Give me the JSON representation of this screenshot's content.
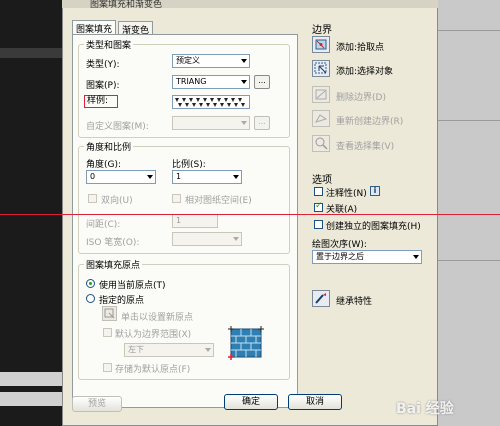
{
  "window": {
    "title": "图案填充和渐变色"
  },
  "tabs": [
    {
      "label": "图案填充",
      "active": true
    },
    {
      "label": "渐变色",
      "active": false
    }
  ],
  "type_pattern": {
    "group_title": "类型和图案",
    "type_label": "类型(Y):",
    "type_value": "预定义",
    "pattern_label": "图案(P):",
    "pattern_value": "TRIANG",
    "pattern_more": "...",
    "sample_label": "样例:",
    "custom_label": "自定义图案(M):",
    "custom_more": "..."
  },
  "angle_scale": {
    "group_title": "角度和比例",
    "angle_label": "角度(G):",
    "angle_value": "0",
    "scale_label": "比例(S):",
    "scale_value": "1",
    "double_label": "双向(U)",
    "relative_label": "相对图纸空间(E)",
    "spacing_label": "间距(C):",
    "spacing_value": "1",
    "iso_label": "ISO 笔宽(O):"
  },
  "origin": {
    "group_title": "图案填充原点",
    "use_current": "使用当前原点(T)",
    "specified": "指定的原点",
    "click_set": "单击以设置新原点",
    "default_boundary": "默认为边界范围(X)",
    "position_value": "左下",
    "store_default": "存储为默认原点(F)"
  },
  "boundary": {
    "title": "边界",
    "add_pick": "添加:拾取点",
    "add_select": "添加:选择对象",
    "remove": "删除边界(D)",
    "recreate": "重新创建边界(R)",
    "view_selection": "查看选择集(V)"
  },
  "options": {
    "title": "选项",
    "annotative": "注释性(N)",
    "info_icon": "i",
    "associative": "关联(A)",
    "separate": "创建独立的图案填充(H)",
    "draw_order_label": "绘图次序(W):",
    "draw_order_value": "置于边界之后"
  },
  "inherit": {
    "label": "继承特性"
  },
  "buttons": {
    "preview": "预览",
    "ok": "确定",
    "cancel": "取消"
  },
  "watermark": "Bai 经验",
  "colors": {
    "accent_red": "#e0203a",
    "check_green": "#21a121"
  }
}
